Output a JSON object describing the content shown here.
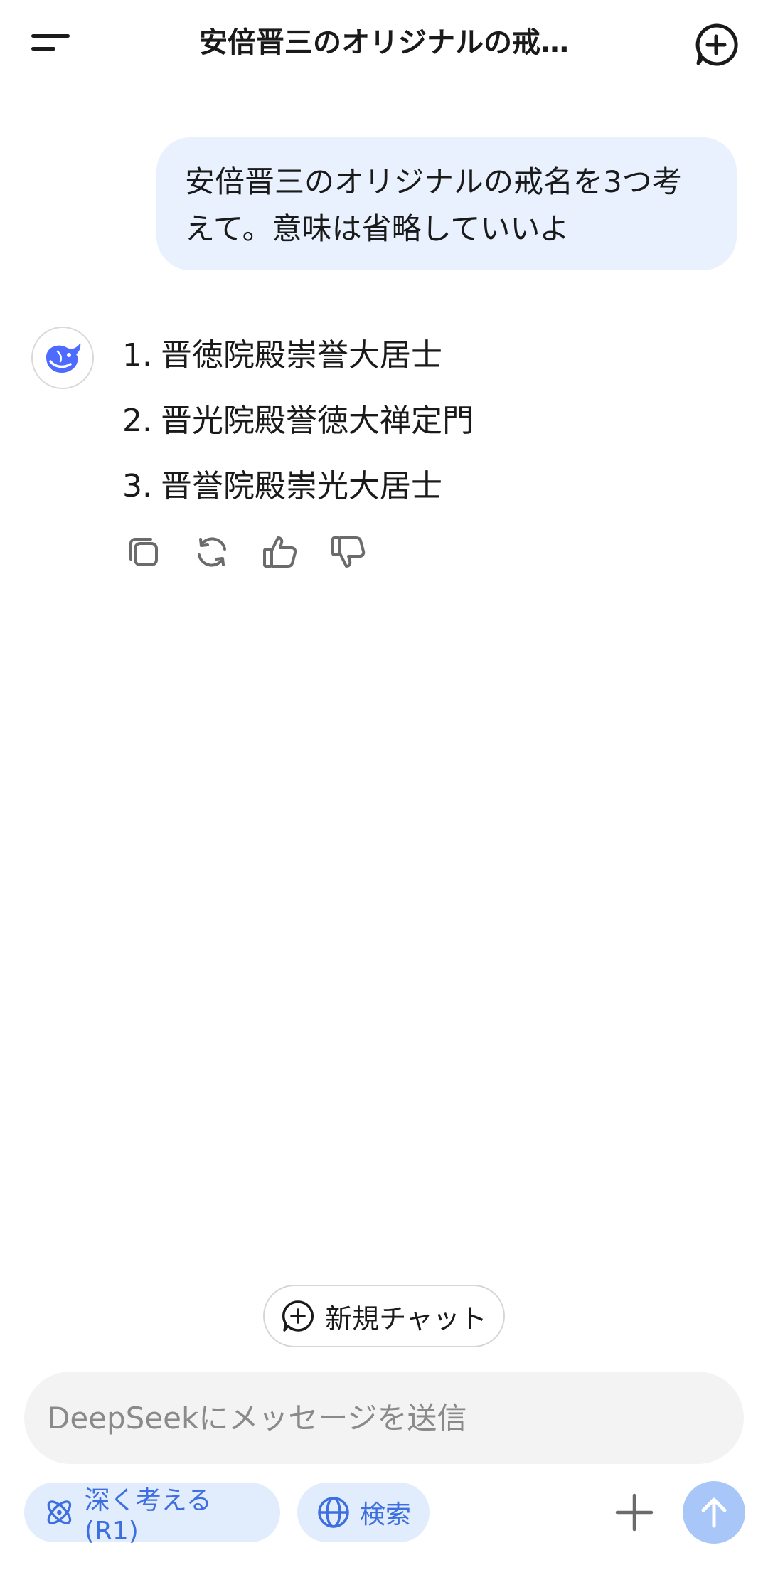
{
  "header": {
    "title": "安倍晋三のオリジナルの戒…",
    "menu_icon": "menu-icon",
    "new_chat_icon": "new-chat-icon"
  },
  "conversation": {
    "user_message": "安倍晋三のオリジナルの戒名を3つ考えて。意味は省略していいよ",
    "assistant_items": [
      {
        "num": "1.",
        "text": "晋徳院殿崇誉大居士"
      },
      {
        "num": "2.",
        "text": "晋光院殿誉徳大禅定門"
      },
      {
        "num": "3.",
        "text": "晋誉院殿崇光大居士"
      }
    ],
    "actions": [
      "copy-icon",
      "regenerate-icon",
      "thumbs-up-icon",
      "thumbs-down-icon"
    ]
  },
  "new_chat_button": {
    "label": "新規チャット"
  },
  "composer": {
    "placeholder": "DeepSeekにメッセージを送信",
    "deep_think_label": "深く考える (R1)",
    "search_label": "検索"
  },
  "colors": {
    "accent": "#3d6fe0",
    "user_bubble": "#e8f1fd",
    "pill_bg": "#e1ecfd",
    "send_button": "#a9c6f8"
  }
}
